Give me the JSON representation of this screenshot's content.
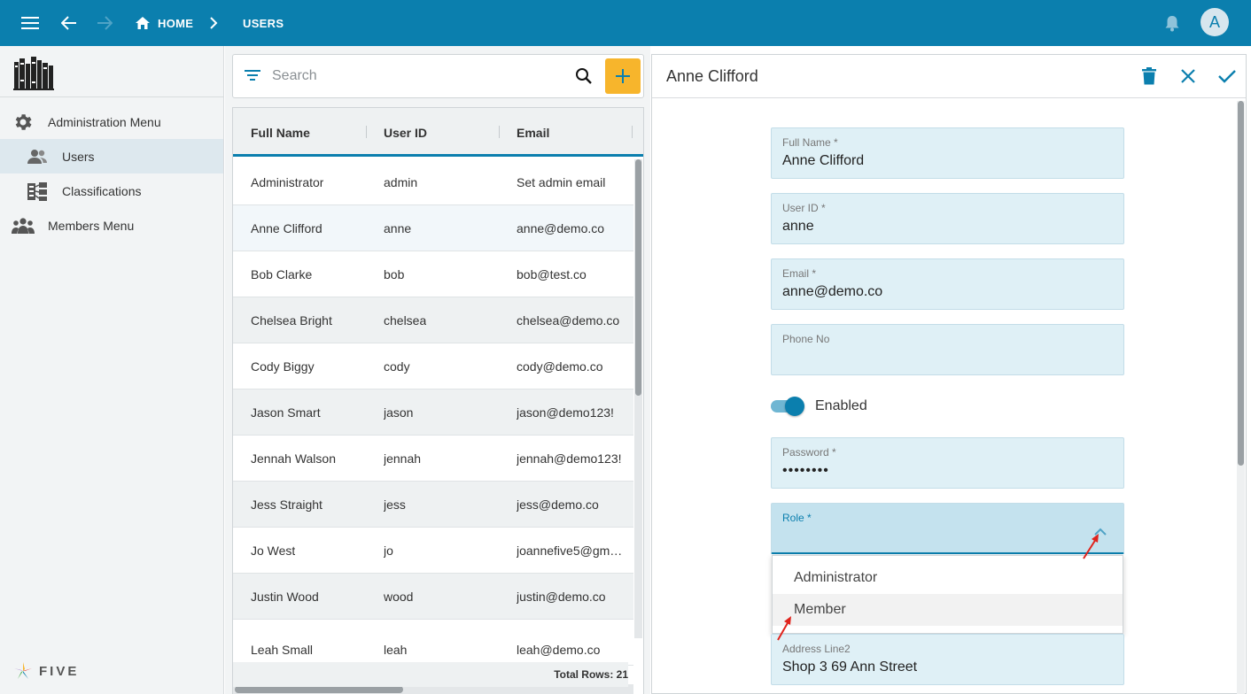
{
  "topbar": {
    "home_label": "HOME",
    "users_label": "USERS",
    "avatar_letter": "A"
  },
  "sidebar": {
    "items": [
      {
        "label": "Administration Menu",
        "icon": "gear-icon"
      },
      {
        "label": "Users",
        "icon": "users-icon"
      },
      {
        "label": "Classifications",
        "icon": "classifications-icon"
      },
      {
        "label": "Members Menu",
        "icon": "members-icon"
      }
    ],
    "brand": "FIVE"
  },
  "search": {
    "placeholder": "Search"
  },
  "grid": {
    "columns": [
      "Full Name",
      "User ID",
      "Email"
    ],
    "rows": [
      {
        "name": "Administrator",
        "id": "admin",
        "email": "Set admin email"
      },
      {
        "name": "Anne Clifford",
        "id": "anne",
        "email": "anne@demo.co"
      },
      {
        "name": "Bob Clarke",
        "id": "bob",
        "email": "bob@test.co"
      },
      {
        "name": "Chelsea Bright",
        "id": "chelsea",
        "email": "chelsea@demo.co"
      },
      {
        "name": "Cody Biggy",
        "id": "cody",
        "email": "cody@demo.co"
      },
      {
        "name": "Jason Smart",
        "id": "jason",
        "email": "jason@demo123!"
      },
      {
        "name": "Jennah Walson",
        "id": "jennah",
        "email": "jennah@demo123!"
      },
      {
        "name": "Jess Straight",
        "id": "jess",
        "email": "jess@demo.co"
      },
      {
        "name": "Jo West",
        "id": "jo",
        "email": "joannefive5@gm…"
      },
      {
        "name": "Justin Wood",
        "id": "wood",
        "email": "justin@demo.co"
      },
      {
        "name": "Leah Small",
        "id": "leah",
        "email": "leah@demo.co"
      }
    ],
    "total_rows": "Total Rows: 21"
  },
  "form": {
    "title": "Anne Clifford",
    "full_name_label": "Full Name *",
    "full_name_value": "Anne Clifford",
    "user_id_label": "User ID *",
    "user_id_value": "anne",
    "email_label": "Email *",
    "email_value": "anne@demo.co",
    "phone_label": "Phone No",
    "phone_value": "",
    "enabled_label": "Enabled",
    "password_label": "Password *",
    "password_value": "••••••••",
    "role_label": "Role *",
    "role_options": [
      "Administrator",
      "Member"
    ],
    "address2_label": "Address Line2",
    "address2_value": "Shop 3 69 Ann Street"
  },
  "colors": {
    "primary": "#0b7fae",
    "accent": "#f7b52c",
    "field_bg": "#dff0f6",
    "annotation": "#e0231c"
  }
}
